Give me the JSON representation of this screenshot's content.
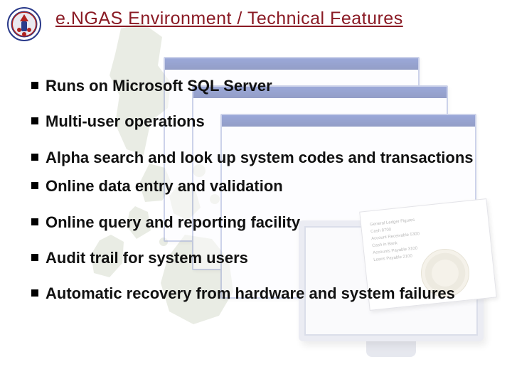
{
  "title": "e.NGAS Environment / Technical Features",
  "bullet_color": "#000000",
  "heading_color": "#8a1a24",
  "features": [
    {
      "text": "Runs on Microsoft SQL Server"
    },
    {
      "text": "Multi-user operations"
    },
    {
      "text": "Alpha search and look up system codes and transactions"
    },
    {
      "text": "Online data entry and validation"
    },
    {
      "text": "Online query and reporting facility"
    },
    {
      "text": "Audit trail for system users"
    },
    {
      "text": "Automatic recovery from hardware and system failures"
    }
  ],
  "doc_lines": [
    "General Ledger Figures",
    "Cash                                   8700",
    "Account Receivable         5300",
    "Cash in Bank",
    "",
    "Accounts Payable             3100",
    "Loans Payable                  2100"
  ]
}
